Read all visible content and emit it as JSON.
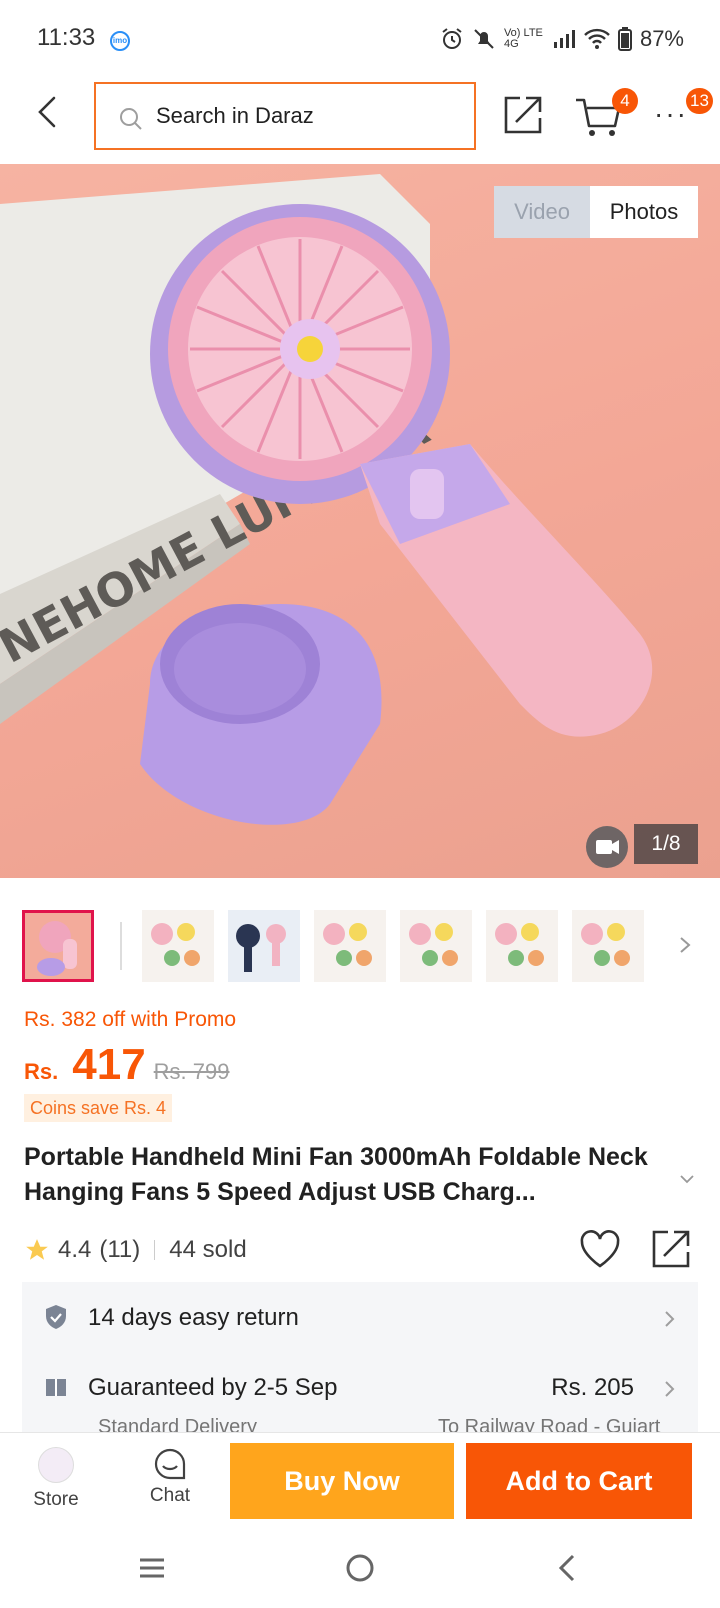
{
  "status": {
    "time": "11:33",
    "app_badge": "imo",
    "network": "Vo) LTE 4G",
    "battery": "87%"
  },
  "header": {
    "search_placeholder": "Search in Daraz",
    "cart_count": "4",
    "more_count": "13"
  },
  "gallery": {
    "toggle_video": "Video",
    "toggle_photos": "Photos",
    "counter": "1/8",
    "thumbnail_count": 7
  },
  "price": {
    "promo_text": "Rs. 382 off with Promo",
    "currency": "Rs.",
    "current": "417",
    "original": "Rs. 799",
    "coins_text": "Coins save Rs. 4"
  },
  "product": {
    "title": "Portable Handheld Mini Fan 3000mAh Foldable Neck Hanging Fans 5 Speed Adjust USB Charg...",
    "rating": "4.4",
    "reviews": "(11)",
    "sold": "44 sold"
  },
  "service": {
    "return_text": "14 days easy return",
    "delivery_text": "Guaranteed by 2-5 Sep",
    "delivery_price": "Rs. 205",
    "delivery_type": "Standard Delivery",
    "delivery_to": "To Railway Road - Gujart"
  },
  "actions": {
    "store_label": "Store",
    "chat_label": "Chat",
    "buy_now_label": "Buy Now",
    "add_to_cart_label": "Add to Cart"
  },
  "colors": {
    "brand_orange": "#f85606",
    "buy_now_yellow": "#ffa51c",
    "search_border": "#f57224",
    "thumb_selected": "#e0134b"
  }
}
